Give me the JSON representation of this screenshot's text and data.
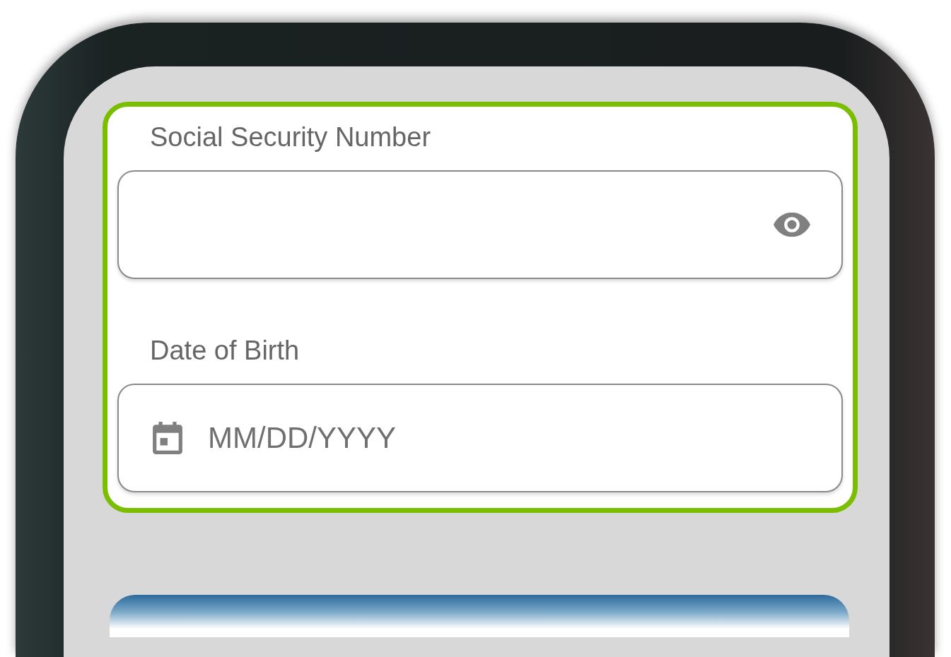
{
  "form": {
    "fields": [
      {
        "label": "Social Security Number",
        "kind": "secret"
      },
      {
        "label": "Date of Birth",
        "kind": "date",
        "placeholder": "MM/DD/YYYY"
      }
    ]
  }
}
